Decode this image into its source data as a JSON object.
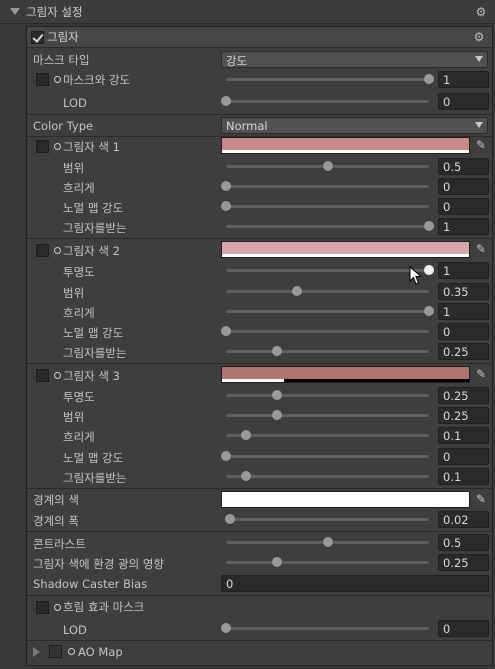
{
  "component": {
    "title": "그림자 설정",
    "section_title": "그림자",
    "section_enabled": true
  },
  "mask_type": {
    "label": "마스크 타입",
    "value": "강도"
  },
  "mask_intensity": {
    "label": "마스크와 강도",
    "value": "1",
    "level": 1.0
  },
  "lod": {
    "label": "LOD",
    "value": "0",
    "level": 0.0
  },
  "color_type": {
    "label": "Color Type",
    "value": "Normal"
  },
  "shadow1": {
    "label": "그림자 색 1",
    "color": "#c48a87",
    "alpha": 1.0,
    "range": {
      "label": "범위",
      "value": "0.5",
      "level": 0.5
    },
    "blur": {
      "label": "흐리게",
      "value": "0",
      "level": 0.0
    },
    "normal_map": {
      "label": "노멀 맵 강도",
      "value": "0",
      "level": 0.0
    },
    "receive": {
      "label": "그림자를받는",
      "value": "1",
      "level": 1.0
    }
  },
  "shadow2": {
    "label": "그림자 색 2",
    "color": "#d4a8ab",
    "alpha": 1.0,
    "opacity": {
      "label": "투명도",
      "value": "1",
      "level": 1.0
    },
    "range": {
      "label": "범위",
      "value": "0.35",
      "level": 0.35
    },
    "blur": {
      "label": "흐리게",
      "value": "1",
      "level": 1.0
    },
    "normal_map": {
      "label": "노멀 맵 강도",
      "value": "0",
      "level": 0.0
    },
    "receive": {
      "label": "그림자를받는",
      "value": "0.25",
      "level": 0.25
    }
  },
  "shadow3": {
    "label": "그림자 색 3",
    "color": "#b07373",
    "alpha": 0.25,
    "opacity": {
      "label": "투명도",
      "value": "0.25",
      "level": 0.25
    },
    "range": {
      "label": "범위",
      "value": "0.25",
      "level": 0.25
    },
    "blur": {
      "label": "흐리게",
      "value": "0.1",
      "level": 0.1
    },
    "normal_map": {
      "label": "노멀 맵 강도",
      "value": "0",
      "level": 0.0
    },
    "receive": {
      "label": "그림자를받는",
      "value": "0.1",
      "level": 0.1
    }
  },
  "border_color": {
    "label": "경계의 색",
    "color": "#ffffff"
  },
  "border_width": {
    "label": "경계의 폭",
    "value": "0.02",
    "level": 0.02
  },
  "contrast": {
    "label": "콘트라스트",
    "value": "0.5",
    "level": 0.5
  },
  "env_light": {
    "label": "그림자 색에 환경 광의 영향",
    "value": "0.25",
    "level": 0.25
  },
  "shadow_caster_bias": {
    "label": "Shadow Caster Bias",
    "value": "0"
  },
  "blur_mask": {
    "label": "흐림 효과 마스크"
  },
  "blur_lod": {
    "label": "LOD",
    "value": "0",
    "level": 0.0
  },
  "ao_map": {
    "label": "AO Map"
  },
  "colors": {
    "panel": "#3e3e3e",
    "header": "#464646",
    "field": "#2a2a2a",
    "track": "#5e5e5e",
    "knob": "#999999"
  },
  "icons": [
    "gear-icon",
    "eyedropper-icon",
    "foldout-arrow-icon",
    "checkbox-icon",
    "mouse-cursor-icon"
  ]
}
